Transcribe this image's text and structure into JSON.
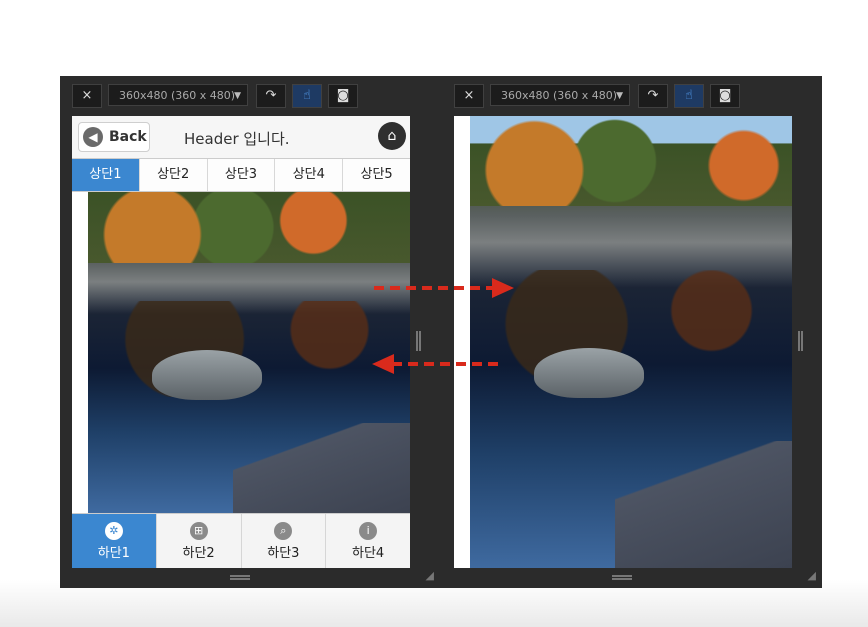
{
  "toolbar": {
    "close": "×",
    "device": "360x480 (360 x 480)",
    "rotate_icon": "rotate-icon",
    "touch_icon": "touch-icon",
    "camera_icon": "camera-icon"
  },
  "left_screen": {
    "back_label": "Back",
    "header_title": "Header 입니다.",
    "top_tabs": [
      "상단1",
      "상단2",
      "상단3",
      "상단4",
      "상단5"
    ],
    "active_top_tab": 0,
    "bottom_tabs": [
      {
        "label": "하단1",
        "icon": "gear-icon"
      },
      {
        "label": "하단2",
        "icon": "grid-icon"
      },
      {
        "label": "하단3",
        "icon": "search-icon"
      },
      {
        "label": "하단4",
        "icon": "info-icon"
      }
    ],
    "active_bottom_tab": 0
  },
  "colors": {
    "accent": "#3b87d0",
    "frame": "#2b2b2b",
    "arrow": "#d92a1c"
  }
}
